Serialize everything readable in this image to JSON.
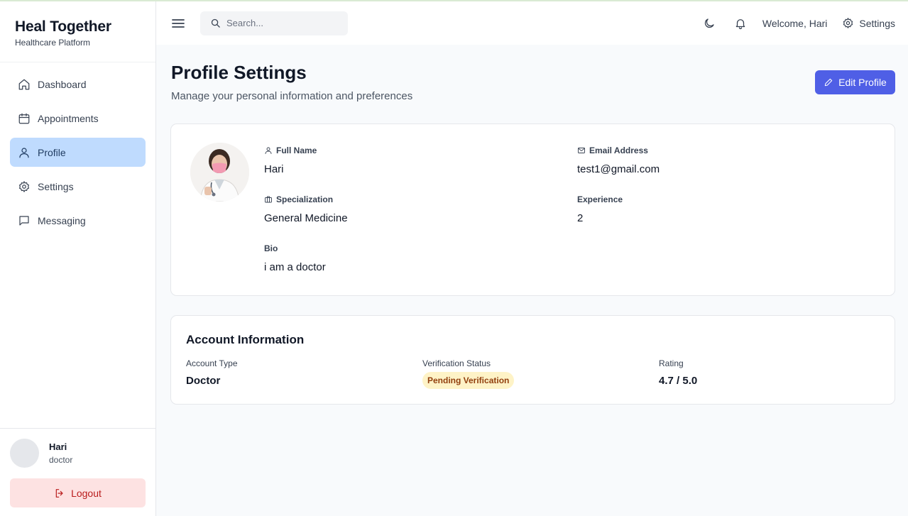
{
  "brand": {
    "title": "Heal Together",
    "subtitle": "Healthcare Platform"
  },
  "sidebar": {
    "items": [
      {
        "label": "Dashboard",
        "icon": "home-icon",
        "active": false
      },
      {
        "label": "Appointments",
        "icon": "calendar-icon",
        "active": false
      },
      {
        "label": "Profile",
        "icon": "user-icon",
        "active": true
      },
      {
        "label": "Settings",
        "icon": "gear-icon",
        "active": false
      },
      {
        "label": "Messaging",
        "icon": "message-icon",
        "active": false
      }
    ],
    "user": {
      "name": "Hari",
      "role": "doctor"
    },
    "logout_label": "Logout"
  },
  "header": {
    "search_placeholder": "Search...",
    "welcome": "Welcome, Hari",
    "settings_label": "Settings"
  },
  "page": {
    "title": "Profile Settings",
    "subtitle": "Manage your personal information and preferences",
    "edit_label": "Edit Profile"
  },
  "profile": {
    "full_name_label": "Full Name",
    "full_name": "Hari",
    "email_label": "Email Address",
    "email": "test1@gmail.com",
    "specialization_label": "Specialization",
    "specialization": "General Medicine",
    "experience_label": "Experience",
    "experience": "2",
    "bio_label": "Bio",
    "bio": "i am a doctor"
  },
  "account": {
    "title": "Account Information",
    "type_label": "Account Type",
    "type": "Doctor",
    "verification_label": "Verification Status",
    "verification": "Pending Verification",
    "rating_label": "Rating",
    "rating": "4.7 / 5.0"
  },
  "colors": {
    "accent": "#4f5fe6",
    "active_nav": "#bfdbfe",
    "logout_bg": "#fde2e2",
    "badge_bg": "#fef3c7"
  }
}
